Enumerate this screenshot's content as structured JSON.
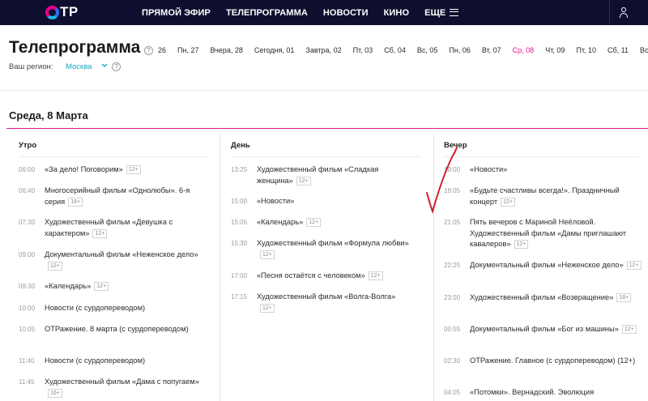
{
  "header": {
    "logo_text": "TP",
    "nav": [
      "ПРЯМОЙ ЭФИР",
      "ТЕЛЕПРОГРАММА",
      "НОВОСТИ",
      "КИНО",
      "ЕЩЕ"
    ]
  },
  "title": "Телепрограмма",
  "help_glyph": "?",
  "dates": [
    "26",
    "Пн, 27",
    "Вчера, 28",
    "Сегодня, 01",
    "Завтра, 02",
    "Пт, 03",
    "Сб, 04",
    "Вс, 05",
    "Пн, 06",
    "Вт, 07",
    "Ср, 08",
    "Чт, 09",
    "Пт, 10",
    "Сб, 11",
    "Вс"
  ],
  "active_date_index": 10,
  "region": {
    "label": "Ваш регион:",
    "value": "Москва"
  },
  "day_title": "Среда, 8 Марта",
  "columns": [
    {
      "heading": "Утро",
      "items": [
        {
          "time": "06:00",
          "title": "«За дело! Поговорим»",
          "age": "12+"
        },
        {
          "time": "06:40",
          "title": "Многосерийный фильм «Однолюбы». 6-я серия",
          "age": "16+"
        },
        {
          "time": "07:30",
          "title": "Художественный фильм «Девушка с характером»",
          "age": "12+"
        },
        {
          "time": "09:00",
          "title": "Документальный фильм «Неженское дело»",
          "age": "12+"
        },
        {
          "time": "09:30",
          "title": "«Календарь»",
          "age": "12+"
        },
        {
          "time": "10:00",
          "title": "Новости (с сурдопереводом)",
          "age": ""
        },
        {
          "time": "10:05",
          "title": "ОТРажение. 8 марта (с сурдопереводом)",
          "age": ""
        },
        {
          "time": "11:40",
          "title": "Новости (с сурдопереводом)",
          "age": ""
        },
        {
          "time": "11:45",
          "title": "Художественный фильм «Дама с попугаем»",
          "age": "16+"
        }
      ]
    },
    {
      "heading": "День",
      "items": [
        {
          "time": "13:25",
          "title": "Художественный фильм «Сладкая женщина»",
          "age": "12+"
        },
        {
          "time": "15:00",
          "title": "«Новости»",
          "age": ""
        },
        {
          "time": "15:05",
          "title": "«Календарь»",
          "age": "12+"
        },
        {
          "time": "15:30",
          "title": "Художественный фильм «Формула любви»",
          "age": "12+"
        },
        {
          "time": "17:00",
          "title": "«Песня остаётся с человеком»",
          "age": "12+"
        },
        {
          "time": "17:15",
          "title": "Художественный фильм «Волга-Волга»",
          "age": "12+"
        }
      ]
    },
    {
      "heading": "Вечер",
      "items": [
        {
          "time": "19:00",
          "title": "«Новости»",
          "age": ""
        },
        {
          "time": "19:05",
          "title": "«Будьте счастливы всегда!». Праздничный концерт",
          "age": "12+"
        },
        {
          "time": "21:05",
          "title": "Пять вечеров с Мариной Неёловой. Художественный фильм «Дамы приглашают кавалеров»",
          "age": "12+"
        },
        {
          "time": "22:25",
          "title": "Документальный фильм «Неженское дело»",
          "age": "12+"
        },
        {
          "time": "23:00",
          "title": "Художественный фильм «Возвращение»",
          "age": "18+"
        },
        {
          "time": "00:55",
          "title": "Документальный фильм «Бог из машины»",
          "age": "12+"
        },
        {
          "time": "02:30",
          "title": "ОТРажение. Главное (с сурдопереводом) (12+)",
          "age": ""
        },
        {
          "time": "04:05",
          "title": "«Потомки». Вернадский. Эволюция",
          "age": ""
        }
      ]
    }
  ],
  "colors": {
    "nav_bg": "#0e0f2f",
    "accent": "#e3168a",
    "region": "#17a9c2",
    "checkmark": "#d0202a"
  }
}
